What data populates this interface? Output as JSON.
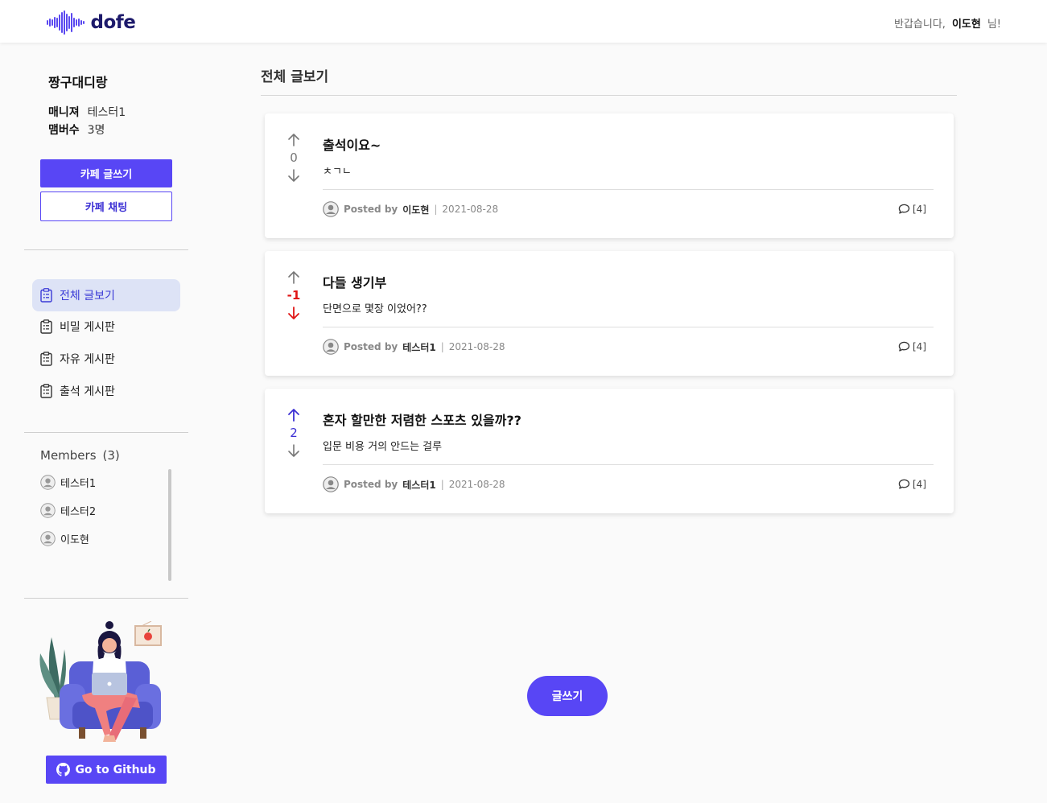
{
  "app": {
    "logo_text": "dofe",
    "brand_color": "#5846f5"
  },
  "header": {
    "greeting": "반갑습니다,",
    "username": "이도현",
    "suffix": "님!"
  },
  "sidebar": {
    "cafe_name": "짱구대디랑",
    "manager_label": "매니져",
    "manager_value": "테스터1",
    "member_count_label": "맴버수",
    "member_count_value": "3명",
    "write_button": "카페 글쓰기",
    "chat_button": "카페 채팅",
    "nav": [
      {
        "label": "전체 글보기",
        "icon": "clipboard-icon",
        "active": true
      },
      {
        "label": "비밀 게시판",
        "icon": "clipboard-icon",
        "active": false
      },
      {
        "label": "자유 게시판",
        "icon": "clipboard-icon",
        "active": false
      },
      {
        "label": "출석 게시판",
        "icon": "clipboard-icon",
        "active": false
      }
    ],
    "members_title": "Members",
    "members_count": "(3)",
    "members": [
      {
        "name": "테스터1",
        "icon": "user-avatar-icon"
      },
      {
        "name": "테스터2",
        "icon": "user-avatar-icon"
      },
      {
        "name": "이도현",
        "icon": "user-avatar-icon"
      }
    ],
    "github_button": "Go to Github"
  },
  "main": {
    "title": "전체 글보기",
    "posts": [
      {
        "title": "출석이요~",
        "body": "ㅊㄱㄴ",
        "votes": "0",
        "vote_state": "neutral",
        "posted_by": "Posted by",
        "author": "이도현",
        "date": "2021-08-28",
        "comments": "[4]"
      },
      {
        "title": "다들 생기부",
        "body": "단면으로 몇장 이었어??",
        "votes": "-1",
        "vote_state": "down",
        "posted_by": "Posted by",
        "author": "테스터1",
        "date": "2021-08-28",
        "comments": "[4]"
      },
      {
        "title": "혼자 할만한 저렴한 스포츠 있을까??",
        "body": "입문 비용 거의 안드는 걸루",
        "votes": "2",
        "vote_state": "up",
        "posted_by": "Posted by",
        "author": "테스터1",
        "date": "2021-08-28",
        "comments": "[4]"
      }
    ],
    "write_button": "글쓰기"
  }
}
